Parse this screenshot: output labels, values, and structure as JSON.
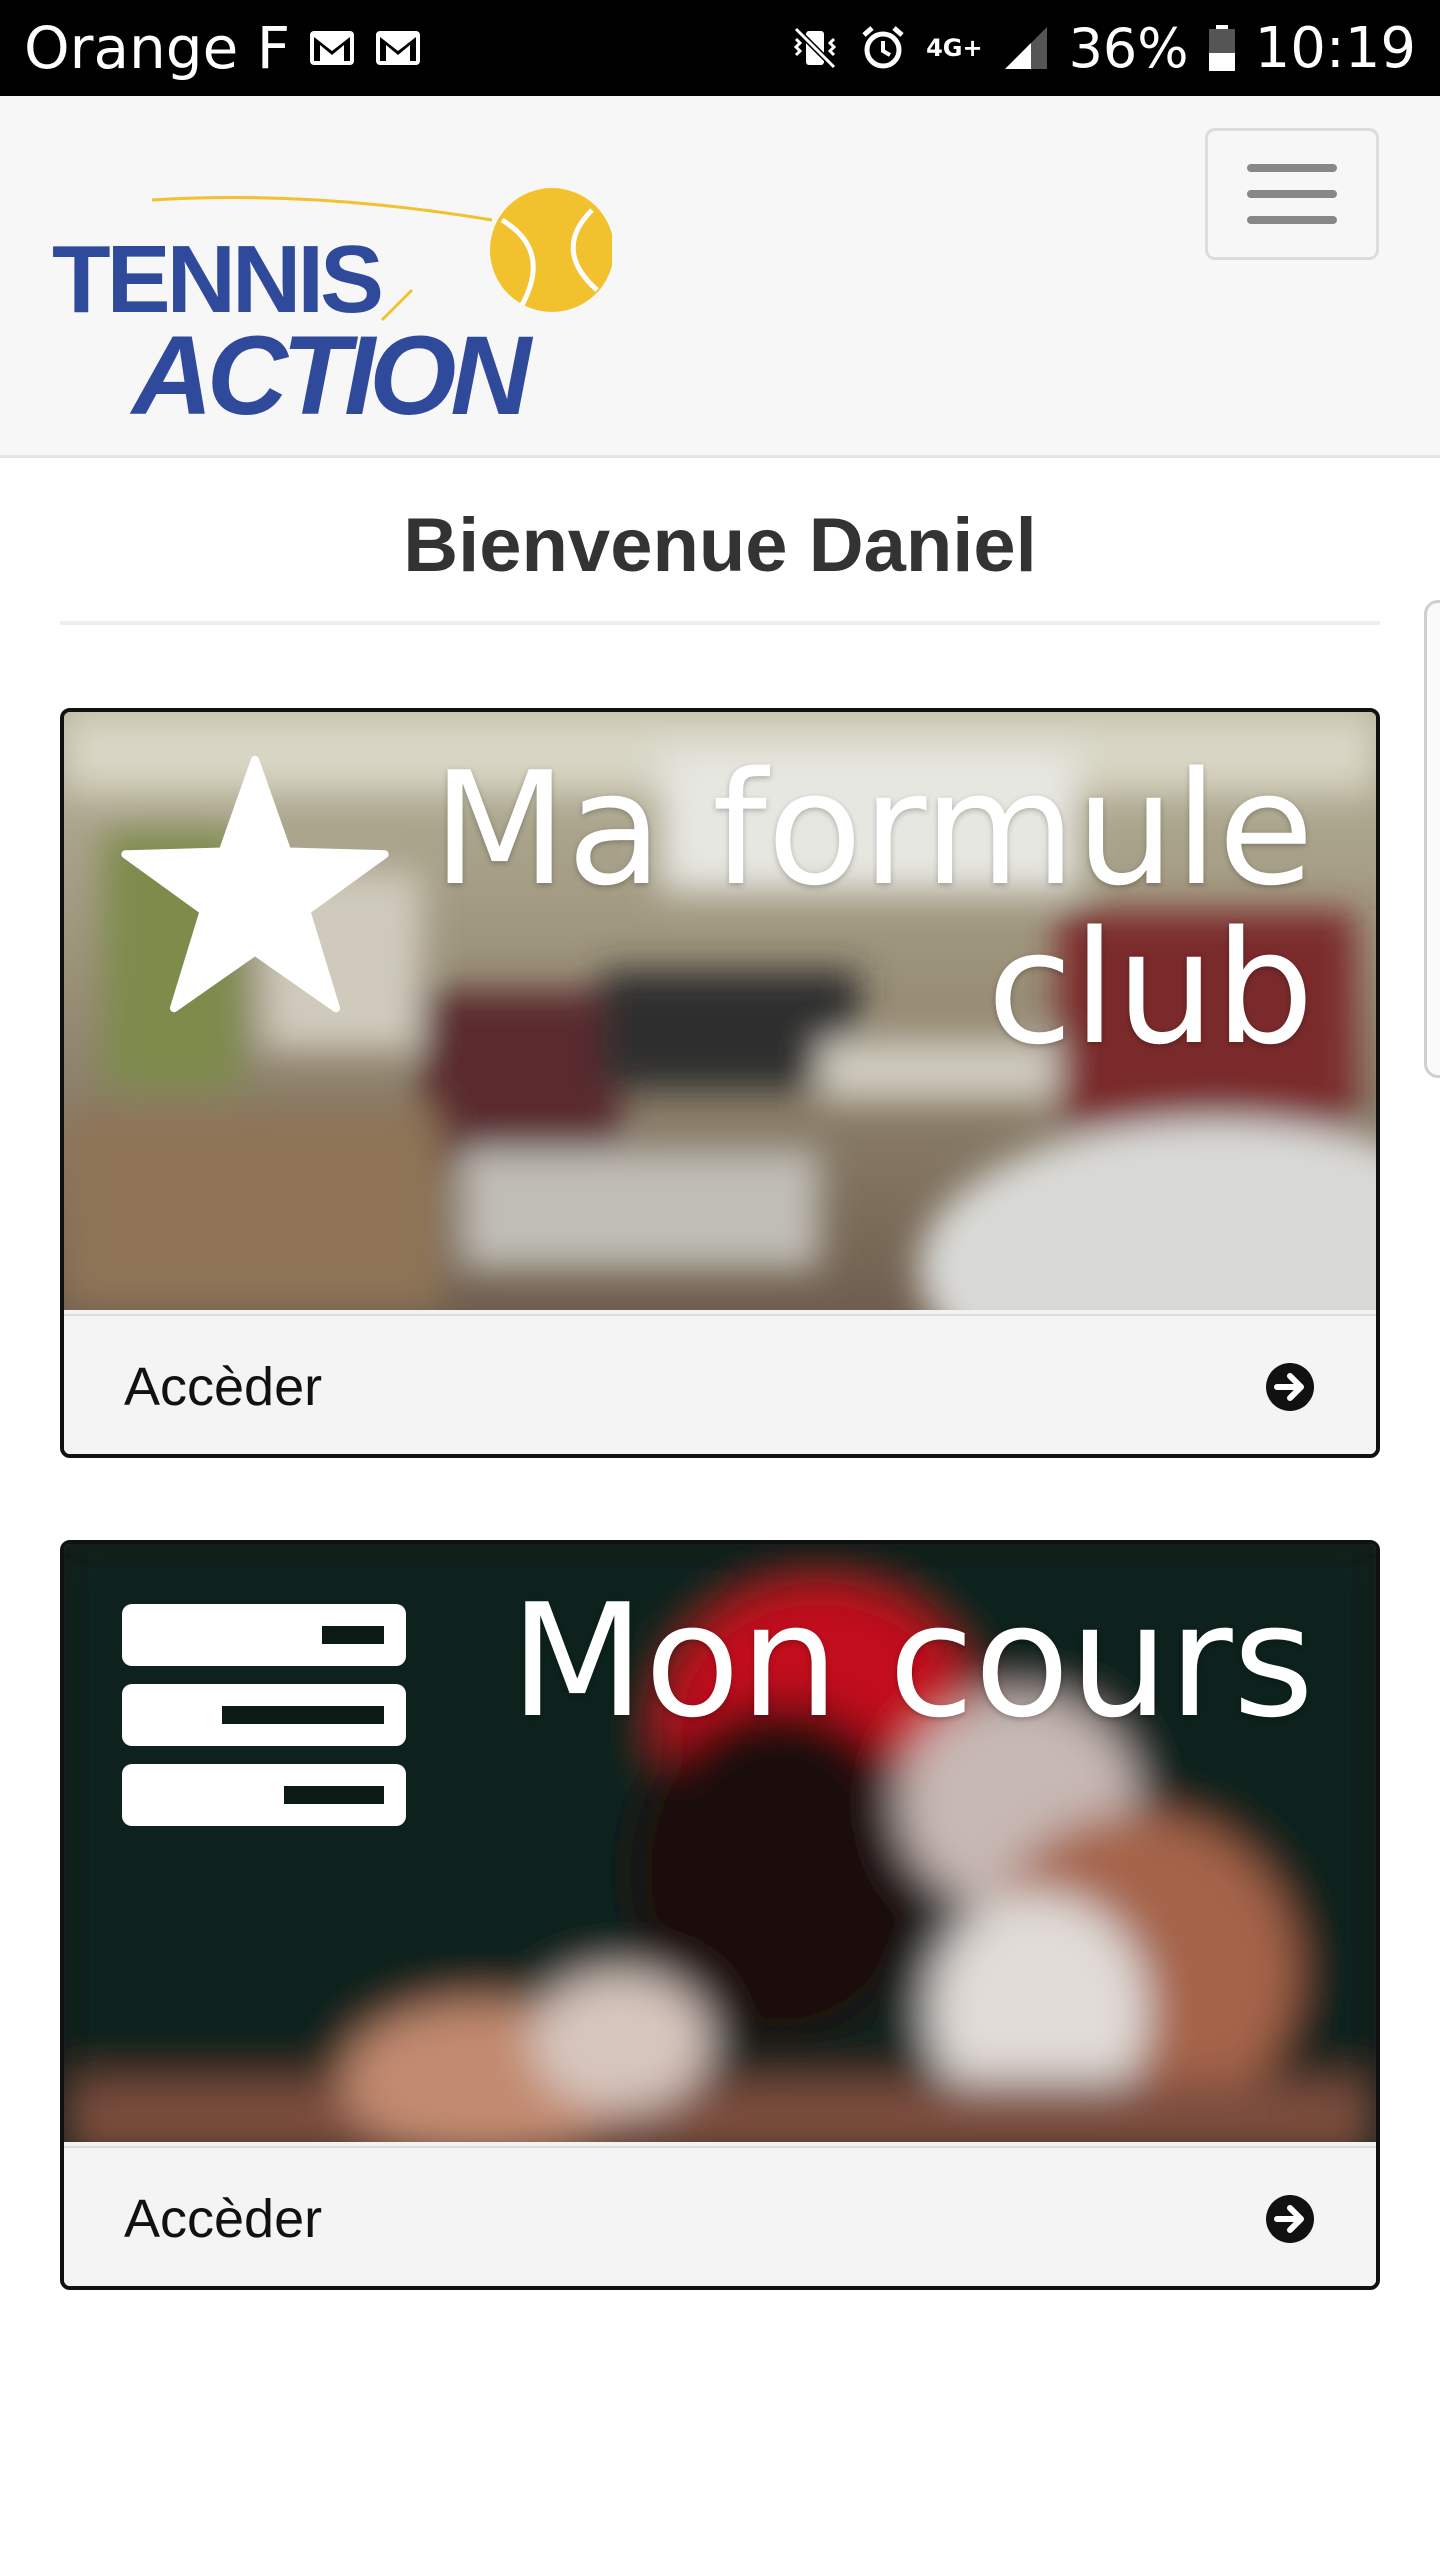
{
  "status_bar": {
    "carrier": "Orange F",
    "network": "4G+",
    "battery": "36%",
    "time": "10:19"
  },
  "navbar": {
    "logo_line1": "TENNIS",
    "logo_line2": "ACTION",
    "menu_icon": "hamburger-icon"
  },
  "welcome": {
    "title": "Bienvenue Daniel"
  },
  "cards": [
    {
      "title_line1": "Ma formule",
      "title_line2": "club",
      "icon": "star-icon",
      "action_label": "Accèder",
      "action_icon": "arrow-circle-right-icon"
    },
    {
      "title_line1": "Mon cours",
      "icon": "server-icon",
      "action_label": "Accèder",
      "action_icon": "arrow-circle-right-icon"
    }
  ],
  "colors": {
    "logo_blue": "#2f4a9a",
    "logo_yellow": "#f2c12e"
  }
}
